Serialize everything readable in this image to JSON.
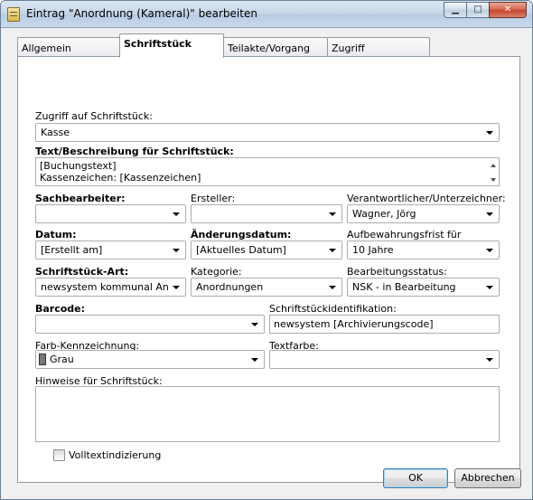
{
  "window": {
    "title": "Eintrag \"Anordnung (Kameral)\" bearbeiten"
  },
  "tabs": [
    {
      "label": "Allgemein"
    },
    {
      "label": "Schriftstück",
      "active": true
    },
    {
      "label": "Teilakte/Vorgang"
    },
    {
      "label": "Zugriff"
    }
  ],
  "form": {
    "zugriff": {
      "label": "Zugriff auf Schriftstück:",
      "value": "Kasse"
    },
    "text": {
      "label": "Text/Beschreibung für Schriftstück:",
      "lines": [
        "[Buchungstext]",
        "Kassenzeichen: [Kassenzeichen]"
      ]
    },
    "sachbearbeiter": {
      "label": "Sachbearbeiter:",
      "value": ""
    },
    "ersteller": {
      "label": "Ersteller:",
      "value": ""
    },
    "verantwortlicher": {
      "label": "Verantwortlicher/Unterzeichner:",
      "value": "Wagner, Jörg"
    },
    "datum": {
      "label": "Datum:",
      "value": "[Erstellt am]"
    },
    "aenderungsdatum": {
      "label": "Änderungsdatum:",
      "value": "[Aktuelles Datum]"
    },
    "aufbewahrung": {
      "label": "Aufbewahrungsfrist für",
      "value": "10 Jahre"
    },
    "art": {
      "label": "Schriftstück-Art:",
      "value": "newsystem kommunal Anordnu"
    },
    "kategorie": {
      "label": "Kategorie:",
      "value": "Anordnungen"
    },
    "status": {
      "label": "Bearbeitungsstatus:",
      "value": "NSK - in Bearbeitung"
    },
    "barcode": {
      "label": "Barcode:",
      "value": ""
    },
    "identifikation": {
      "label": "Schriftstückidentifikation:",
      "value": "newsystem [Archivierungscode]"
    },
    "farbe": {
      "label": "Farb-Kennzeichnung:",
      "value": "Grau",
      "swatch_color": "#777777"
    },
    "textfarbe": {
      "label": "Textfarbe:",
      "value": ""
    },
    "hinweise": {
      "label": "Hinweise für Schriftstück:",
      "value": ""
    },
    "volltext": {
      "label": "Volltextindizierung",
      "checked": false
    }
  },
  "buttons": {
    "ok": "OK",
    "cancel": "Abbrechen"
  },
  "colors": {
    "accent": "#3c7fb1",
    "titlebar": "#c6d6e8",
    "close": "#c5432c"
  }
}
